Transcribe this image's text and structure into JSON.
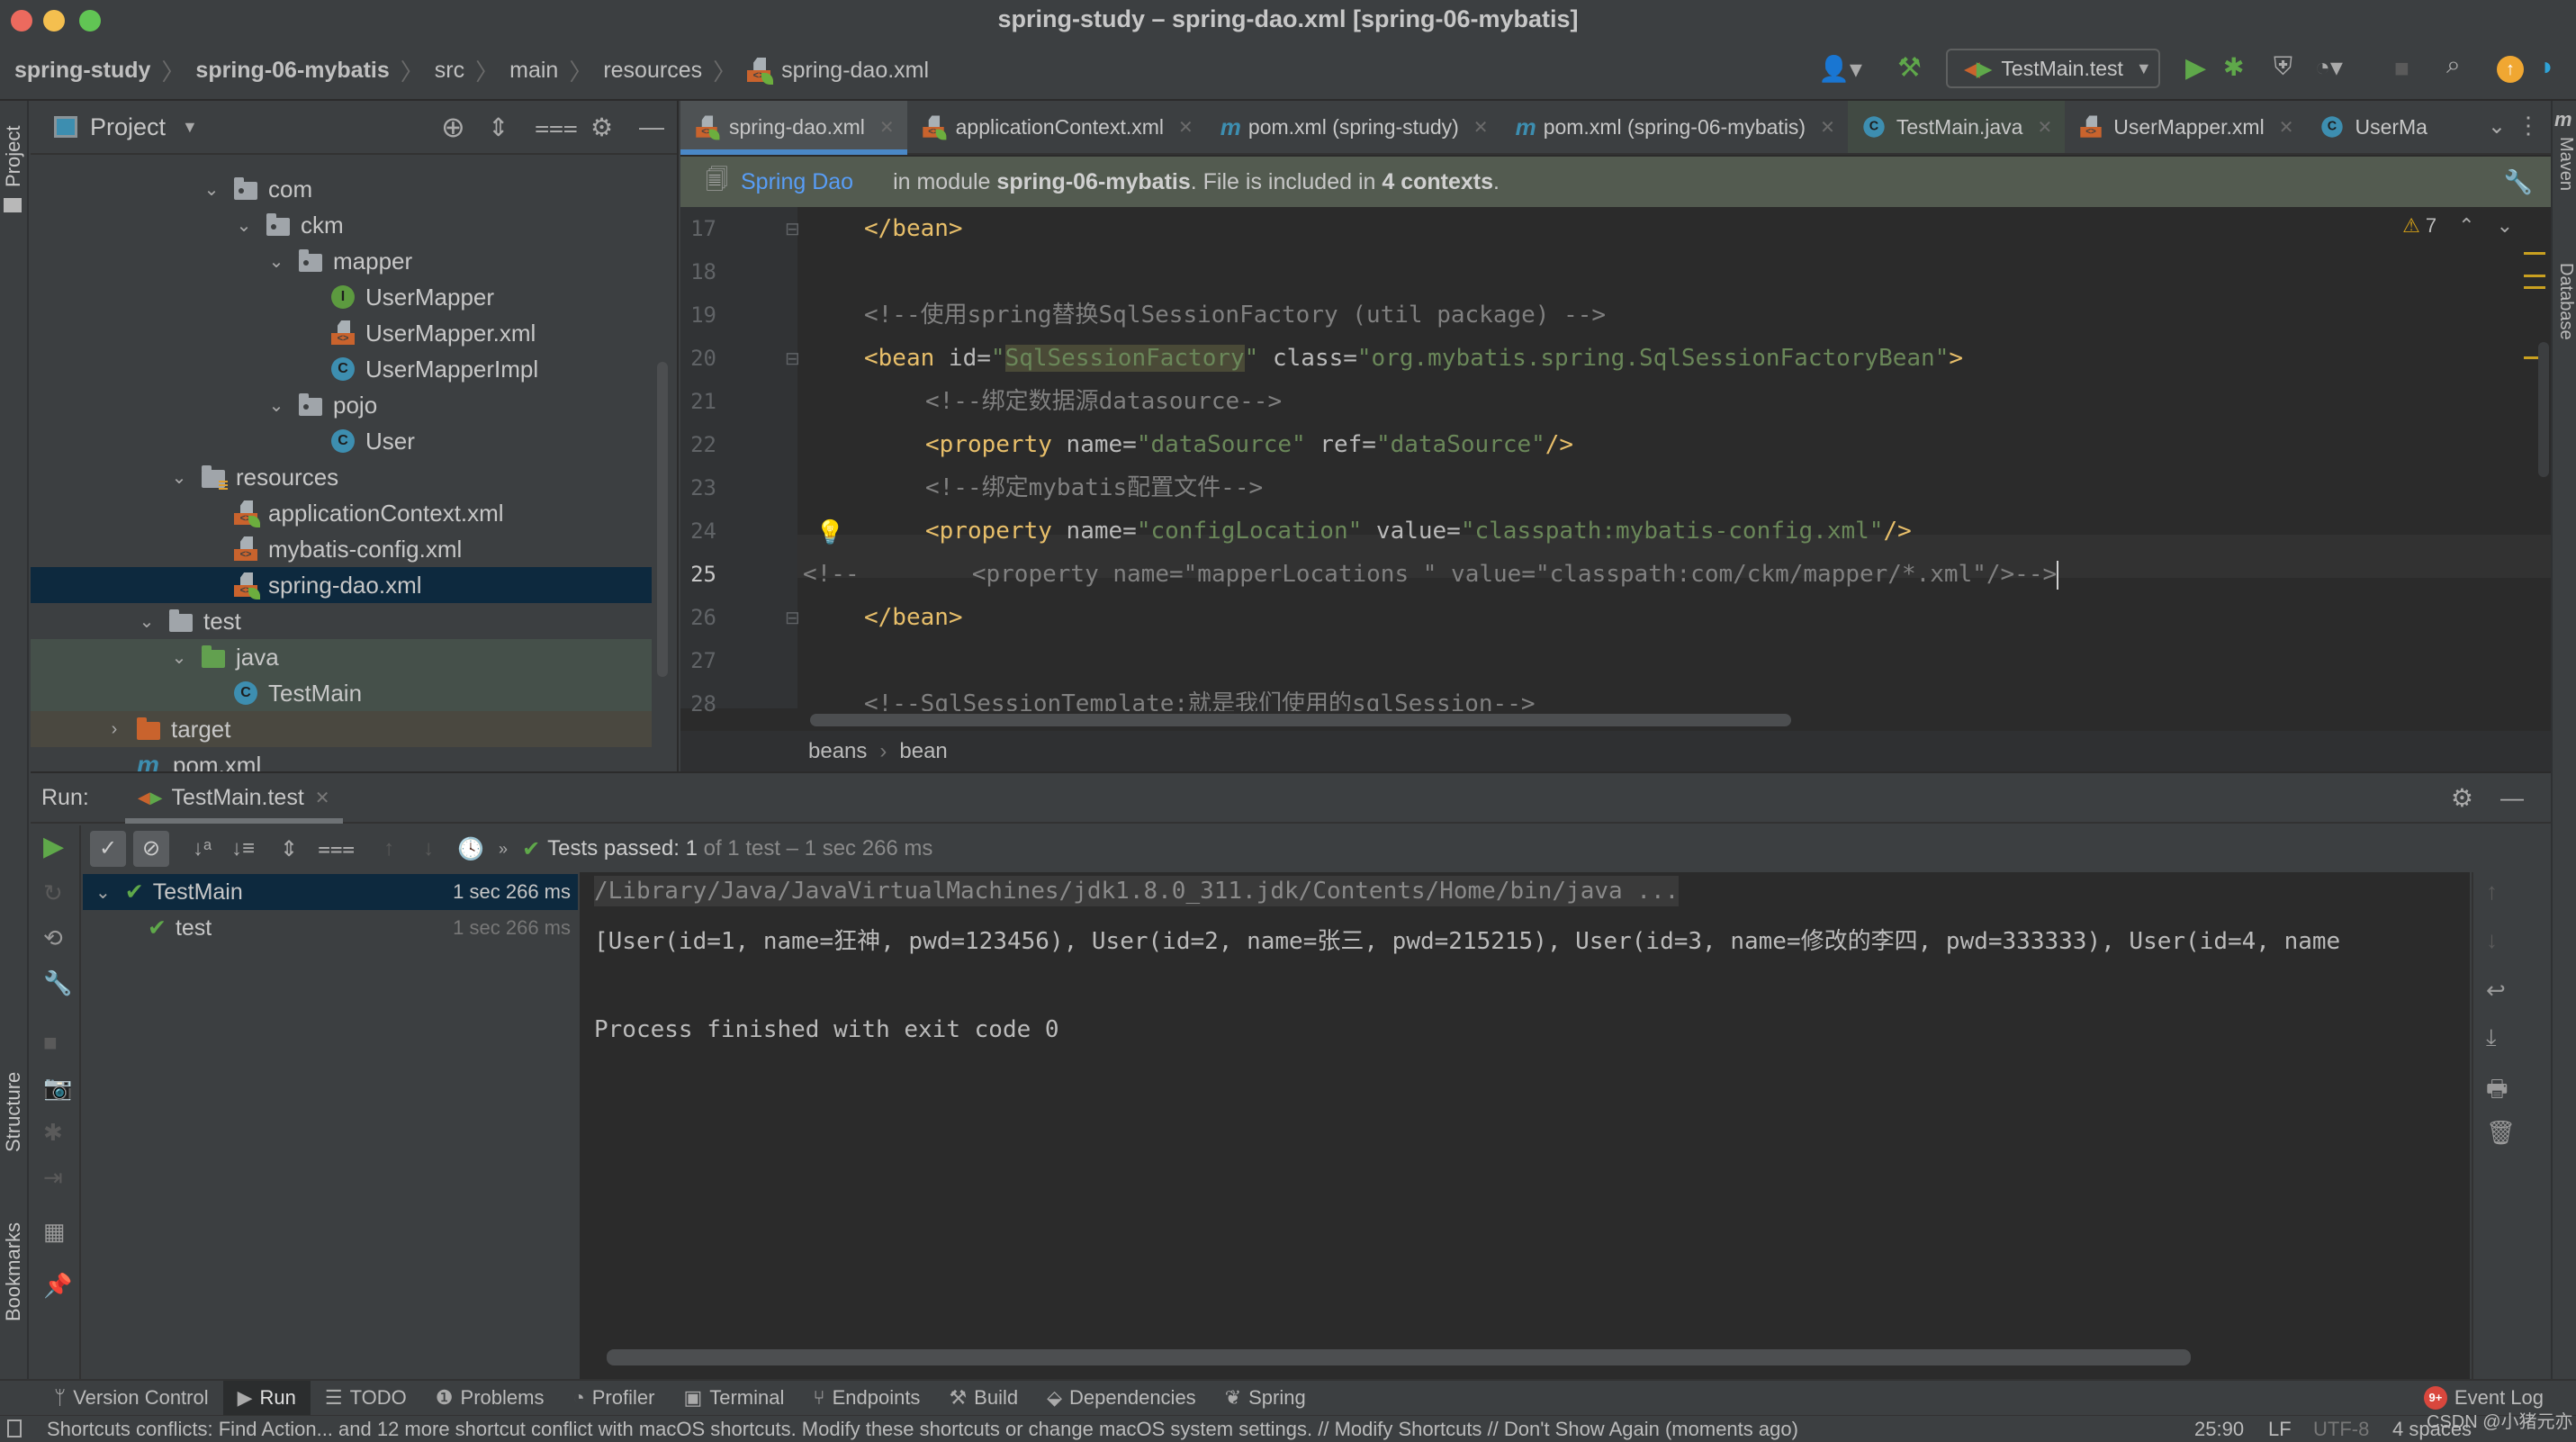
{
  "window": {
    "title": "spring-study – spring-dao.xml [spring-06-mybatis]"
  },
  "navbar": {
    "breadcrumbs": [
      "spring-study",
      "spring-06-mybatis",
      "src",
      "main",
      "resources",
      "spring-dao.xml"
    ],
    "run_config": "TestMain.test",
    "icons": [
      "user-icon",
      "build-hammer-icon",
      "run-icon",
      "debug-icon",
      "coverage-icon",
      "profile-icon",
      "stop-icon",
      "search-icon",
      "update-icon",
      "toolbox-icon"
    ]
  },
  "left_stripe": {
    "project_label": "Project",
    "structure_label": "Structure",
    "bookmarks_label": "Bookmarks"
  },
  "right_stripe": {
    "maven_label": "Maven",
    "database_label": "Database"
  },
  "project_panel": {
    "title": "Project",
    "tree": [
      {
        "label": "com",
        "type": "package",
        "expanded": true
      },
      {
        "label": "ckm",
        "type": "package",
        "expanded": true
      },
      {
        "label": "mapper",
        "type": "package",
        "expanded": true
      },
      {
        "label": "UserMapper",
        "type": "interface"
      },
      {
        "label": "UserMapper.xml",
        "type": "xml"
      },
      {
        "label": "UserMapperImpl",
        "type": "class"
      },
      {
        "label": "pojo",
        "type": "package",
        "expanded": true
      },
      {
        "label": "User",
        "type": "class"
      },
      {
        "label": "resources",
        "type": "resources-folder",
        "expanded": true
      },
      {
        "label": "applicationContext.xml",
        "type": "spring-xml"
      },
      {
        "label": "mybatis-config.xml",
        "type": "xml"
      },
      {
        "label": "spring-dao.xml",
        "type": "spring-xml",
        "selected": true
      },
      {
        "label": "test",
        "type": "folder",
        "expanded": true
      },
      {
        "label": "java",
        "type": "test-folder",
        "expanded": true
      },
      {
        "label": "TestMain",
        "type": "test-class"
      },
      {
        "label": "target",
        "type": "excluded-folder",
        "expanded": false
      },
      {
        "label": "pom.xml",
        "type": "maven"
      }
    ]
  },
  "editor": {
    "tabs": [
      {
        "label": "spring-dao.xml",
        "icon": "spring-xml",
        "active": true
      },
      {
        "label": "applicationContext.xml",
        "icon": "spring-xml"
      },
      {
        "label": "pom.xml (spring-study)",
        "icon": "maven"
      },
      {
        "label": "pom.xml (spring-06-mybatis)",
        "icon": "maven"
      },
      {
        "label": "TestMain.java",
        "icon": "test-class"
      },
      {
        "label": "UserMapper.xml",
        "icon": "xml"
      },
      {
        "label": "UserMa",
        "icon": "class"
      }
    ],
    "banner": {
      "link": "Spring Dao",
      "text_pre": "in module ",
      "module": "spring-06-mybatis",
      "text_mid": ". File is included in ",
      "contexts": "4 contexts",
      "text_end": "."
    },
    "warnings_count": "7",
    "line_numbers": [
      "17",
      "18",
      "19",
      "20",
      "21",
      "22",
      "23",
      "24",
      "25",
      "26",
      "27",
      "28"
    ],
    "code": {
      "l17_tag": "</bean>",
      "l19_comment": "<!--使用spring替换SqlSessionFactory (util package) -->",
      "l20_open": "<bean",
      "l20_attr1": " id=",
      "l20_q1": "\"",
      "l20_val1": "SqlSessionFactory",
      "l20_q2": "\"",
      "l20_attr2": " class=",
      "l20_val2": "\"org.mybatis.spring.SqlSessionFactoryBean\"",
      "l20_close": ">",
      "l21_comment": "<!--绑定数据源datasource-->",
      "l22_open": "<property",
      "l22_attr1": " name=",
      "l22_val1": "\"dataSource\"",
      "l22_attr2": " ref=",
      "l22_val2": "\"dataSource\"",
      "l22_close": "/>",
      "l23_comment": "<!--绑定mybatis配置文件-->",
      "l24_open": "<property",
      "l24_attr1": " name=",
      "l24_val1": "\"configLocation\"",
      "l24_attr2": " value=",
      "l24_val2": "\"classpath:mybatis-config.xml\"",
      "l24_close": "/>",
      "l25_comment": "<!--        <property name=\"mapperLocations \" value=\"classpath:com/ckm/mapper/*.xml\"/>-->",
      "l26_tag": "</bean>",
      "l28_comment": "<!--SqlSessionTemplate:就是我们使用的sqlSession-->"
    },
    "breadcrumb": [
      "beans",
      "bean"
    ]
  },
  "run_panel": {
    "label": "Run:",
    "tab": "TestMain.test",
    "status_prefix": "Tests passed: ",
    "status_passed": "1",
    "status_suffix": " of 1 test – 1 sec 266 ms",
    "tests": [
      {
        "name": "TestMain",
        "duration": "1 sec 266 ms",
        "status": "passed"
      },
      {
        "name": "test",
        "duration": "1 sec 266 ms",
        "status": "passed"
      }
    ],
    "console": [
      "/Library/Java/JavaVirtualMachines/jdk1.8.0_311.jdk/Contents/Home/bin/java ...",
      "[User(id=1, name=狂神, pwd=123456), User(id=2, name=张三, pwd=215215), User(id=3, name=修改的李四, pwd=333333), User(id=4, name",
      "",
      "Process finished with exit code 0"
    ]
  },
  "bottom_toolbar": {
    "items": [
      {
        "label": "Version Control",
        "icon": "vcs-icon"
      },
      {
        "label": "Run",
        "icon": "run-icon",
        "active": true
      },
      {
        "label": "TODO",
        "icon": "todo-icon"
      },
      {
        "label": "Problems",
        "icon": "problems-icon"
      },
      {
        "label": "Profiler",
        "icon": "profiler-icon"
      },
      {
        "label": "Terminal",
        "icon": "terminal-icon"
      },
      {
        "label": "Endpoints",
        "icon": "endpoints-icon"
      },
      {
        "label": "Build",
        "icon": "build-icon"
      },
      {
        "label": "Dependencies",
        "icon": "dependencies-icon"
      },
      {
        "label": "Spring",
        "icon": "spring-icon"
      }
    ],
    "event_log": "Event Log",
    "event_badge": "9+"
  },
  "status_bar": {
    "message": "Shortcuts conflicts: Find Action... and 12 more shortcut conflict with macOS shortcuts. Modify these shortcuts or change macOS system settings. // Modify Shortcuts // Don't Show Again (moments ago)",
    "position": "25:90",
    "line_sep": "LF",
    "encoding": "UTF-8",
    "indent": "4 spaces",
    "watermark": "CSDN @小猪元亦"
  }
}
